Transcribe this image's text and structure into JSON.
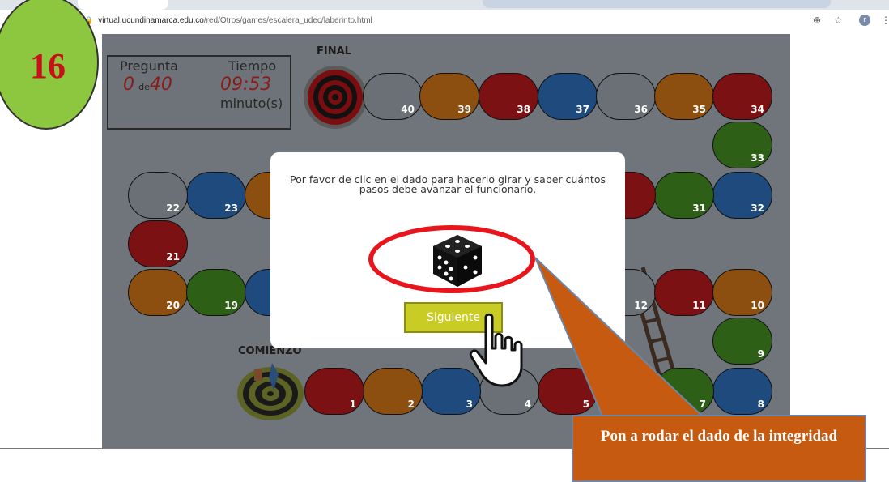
{
  "browser": {
    "url_host": "virtual.ucundinamarca.edu.co",
    "url_path": "/red/Otros/games/escalera_udec/laberinto.html",
    "zoom_icon": "zoom-icon",
    "star_icon": "star-icon",
    "profile_initial": "r",
    "menu_icon": "menu-icon"
  },
  "badge": {
    "number": "16",
    "color": "#8dc63f"
  },
  "score": {
    "question_label": "Pregunta",
    "question_current": "0",
    "question_separator": "de",
    "question_total": "40",
    "time_label": "Tiempo",
    "time_value": "09:53",
    "time_unit": "minuto(s)"
  },
  "board": {
    "final_label": "FINAL",
    "start_label": "COMIENZO",
    "cells": [
      {
        "n": "40",
        "color": "gray"
      },
      {
        "n": "39",
        "color": "orange"
      },
      {
        "n": "38",
        "color": "red"
      },
      {
        "n": "37",
        "color": "blue"
      },
      {
        "n": "36",
        "color": "gray"
      },
      {
        "n": "35",
        "color": "orange"
      },
      {
        "n": "34",
        "color": "red"
      },
      {
        "n": "33",
        "color": "green"
      },
      {
        "n": "32",
        "color": "blue"
      },
      {
        "n": "31",
        "color": "green"
      },
      {
        "n": "23",
        "color": "blue"
      },
      {
        "n": "22",
        "color": "gray"
      },
      {
        "n": "21",
        "color": "red"
      },
      {
        "n": "20",
        "color": "orange"
      },
      {
        "n": "19",
        "color": "green"
      },
      {
        "n": "12",
        "color": "gray"
      },
      {
        "n": "11",
        "color": "red"
      },
      {
        "n": "10",
        "color": "orange"
      },
      {
        "n": "9",
        "color": "green"
      },
      {
        "n": "8",
        "color": "blue"
      },
      {
        "n": "7",
        "color": "green"
      },
      {
        "n": "5",
        "color": "red"
      },
      {
        "n": "4",
        "color": "gray"
      },
      {
        "n": "3",
        "color": "blue"
      },
      {
        "n": "2",
        "color": "orange"
      },
      {
        "n": "1",
        "color": "red"
      }
    ]
  },
  "modal": {
    "message": "Por favor de clic en el dado para hacerlo girar y saber cuántos pasos debe avanzar el funcionario.",
    "dice_icon": "dice-icon",
    "next_button": "Siguiente"
  },
  "callout": {
    "text": "Pon a rodar el dado de la integridad",
    "color": "#c65a10"
  }
}
